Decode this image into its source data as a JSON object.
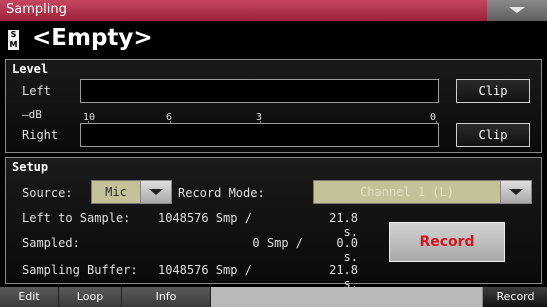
{
  "window": {
    "title": "Sampling"
  },
  "sample": {
    "name": "<Empty>",
    "icon_letters": "S M"
  },
  "level": {
    "title": "Level",
    "left_label": "Left",
    "right_label": "Right",
    "db_label": "–dB",
    "scale": [
      "10",
      "6",
      "3",
      "0"
    ],
    "clip_left": "Clip",
    "clip_right": "Clip"
  },
  "setup": {
    "title": "Setup",
    "source_label": "Source:",
    "source_value": "Mic",
    "record_mode_label": "Record Mode:",
    "record_mode_value": "Channel 1 (L)",
    "left_to_sample_label": "Left to Sample:",
    "left_to_sample_smp": "1048576 Smp /",
    "left_to_sample_sec": "21.8 s.",
    "sampled_label": "Sampled:",
    "sampled_smp": "0 Smp /",
    "sampled_sec": "0.0 s.",
    "buffer_label": "Sampling Buffer:",
    "buffer_smp": "1048576 Smp /",
    "buffer_sec": "21.8 s.",
    "record_button": "Record"
  },
  "tabs": [
    "Edit",
    "Loop",
    "Info",
    "Record"
  ],
  "colors": {
    "title_bar": "#b3304a",
    "record_text": "#d01820",
    "combo_field": "#c5c29a"
  }
}
